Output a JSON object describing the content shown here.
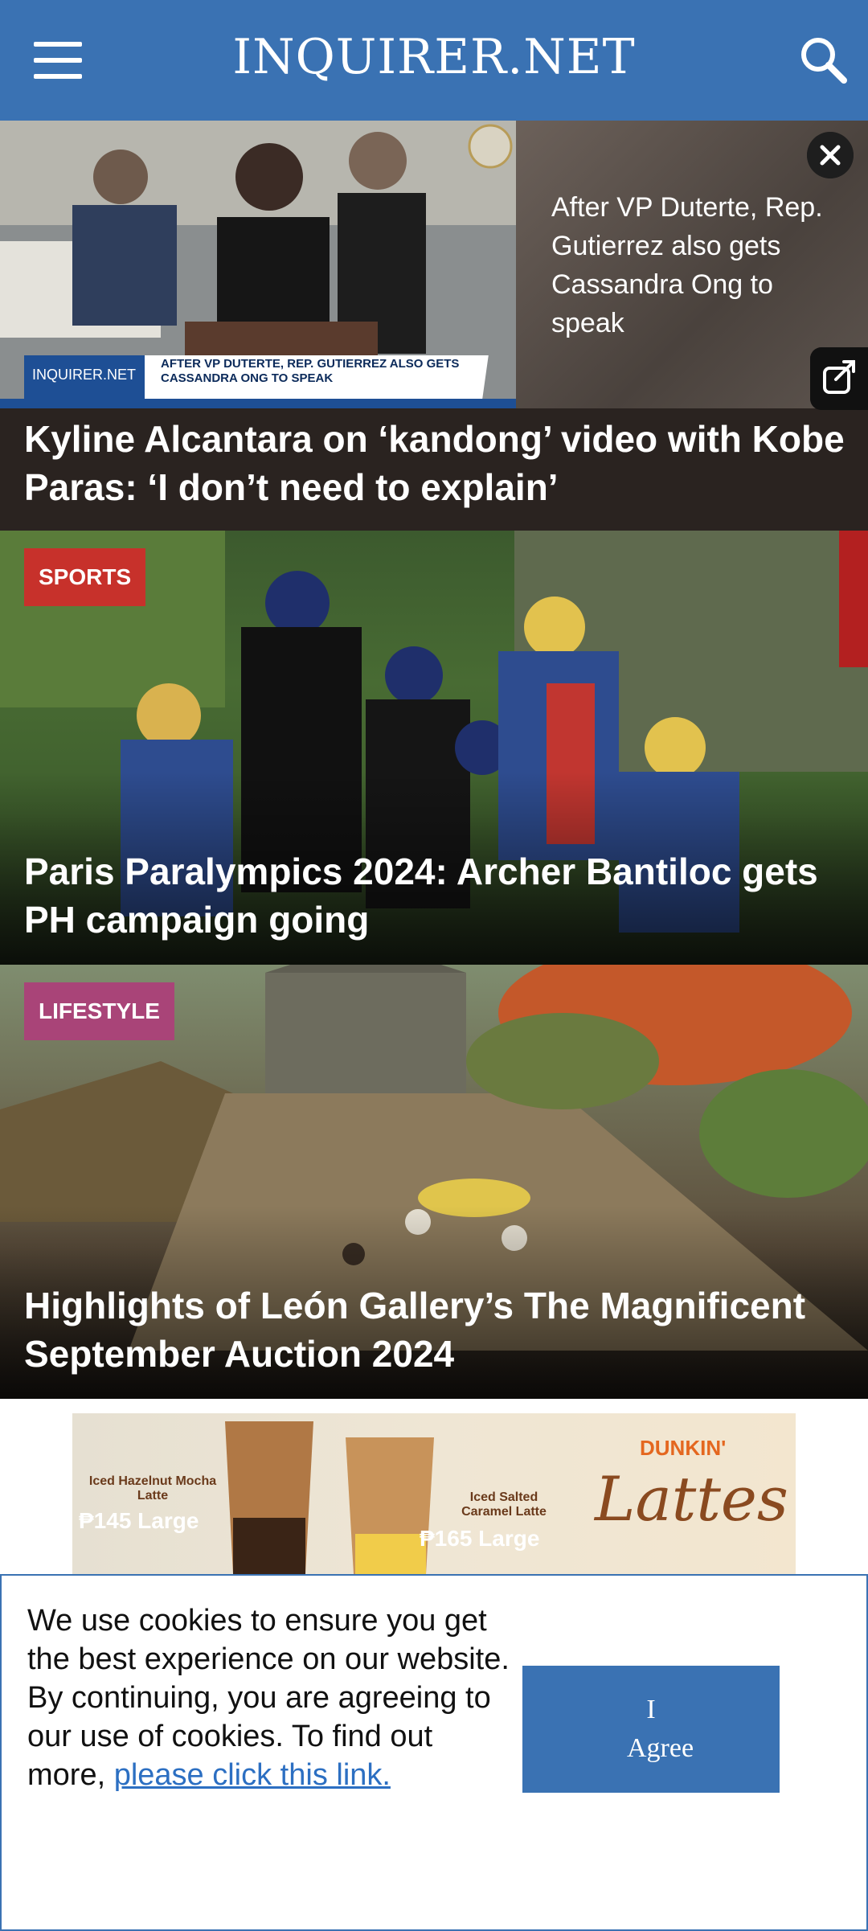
{
  "header": {
    "logo": "INQUIRER.NET",
    "menu_icon": "hamburger-menu-icon",
    "search_icon": "search-icon",
    "background_color": "#3a72b3"
  },
  "video": {
    "caption": "After VP Duterte, Rep. Gutierrez also gets Cassandra Ong to speak",
    "chyron_logo": "INQUIRER.NET",
    "chyron_text": "AFTER VP DUTERTE, REP. GUTIERREZ ALSO GETS CASSANDRA ONG TO SPEAK",
    "close_icon": "close-icon",
    "share_icon": "external-share-icon"
  },
  "stories": [
    {
      "title": "Kyline Alcantara on ‘kandong’ video with Kobe Paras: ‘I don’t need to explain’"
    },
    {
      "category": "SPORTS",
      "title": "Paris Paralympics 2024: Archer Bantiloc gets PH campaign going",
      "category_color": "#c7312b"
    },
    {
      "category": "LIFESTYLE",
      "title": "Highlights of León Gallery’s The Magnificent September Auction 2024",
      "category_color": "#a94478"
    }
  ],
  "ad": {
    "brand": "DUNKIN'",
    "product_script": "Lattes",
    "item1_name": "Iced Hazelnut Mocha Latte",
    "item1_price": "₱145 Large",
    "item2_name": "Iced Salted Caramel Latte",
    "item2_price": "₱165 Large"
  },
  "cookie": {
    "text": "We use cookies to ensure you get the best experience on our website. By continuing, you are agreeing to our use of cookies. To find out more, ",
    "link_text": "please click this link.",
    "button_label": "I Agree"
  }
}
